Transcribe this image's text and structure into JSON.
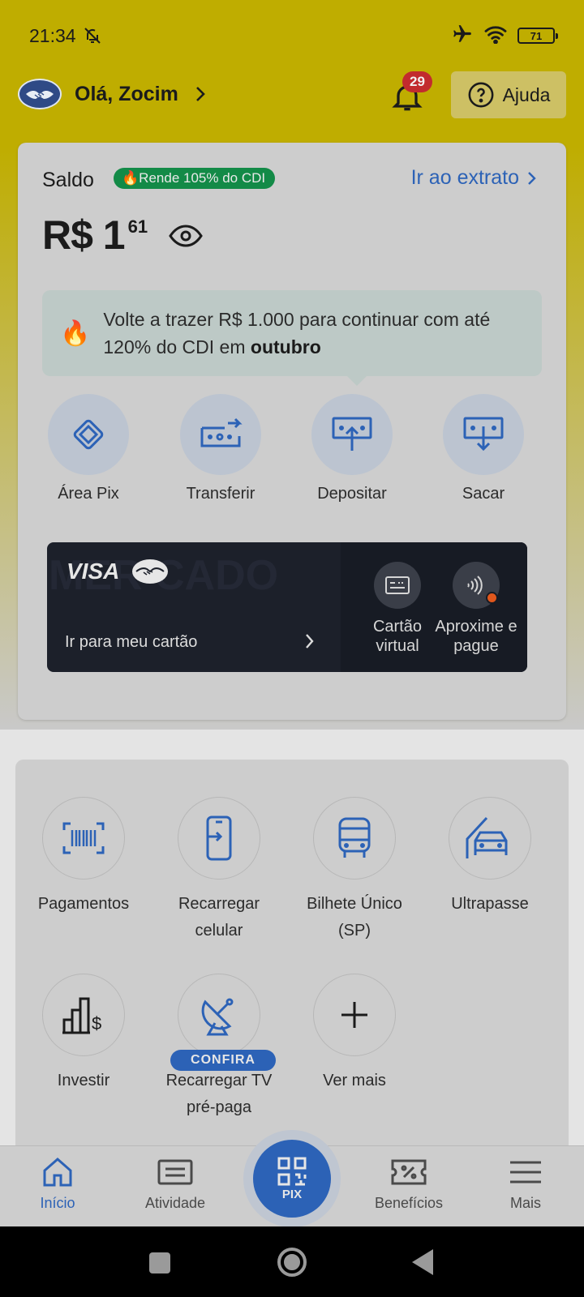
{
  "status_bar": {
    "time": "21:34",
    "battery": "71"
  },
  "header": {
    "greeting": "Olá, Zocim",
    "notification_count": "29",
    "help_label": "Ajuda"
  },
  "balance_card": {
    "saldo_label": "Saldo",
    "rende_badge": "Rende 105% do CDI",
    "extrato_link": "Ir ao extrato",
    "amount_main": "R$ 1",
    "amount_cents": "61",
    "tip_text_prefix": "Volte a trazer R$ 1.000 para continuar com até 120% do CDI em ",
    "tip_text_bold": "outubro",
    "actions": [
      {
        "label": "Área Pix",
        "icon": "pix-icon"
      },
      {
        "label": "Transferir",
        "icon": "transfer-icon"
      },
      {
        "label": "Depositar",
        "icon": "deposit-icon"
      },
      {
        "label": "Sacar",
        "icon": "withdraw-icon"
      }
    ]
  },
  "visa_card": {
    "brand": "VISA",
    "watermark": "MER CADO",
    "goto_label": "Ir para meu cartão",
    "virtual_label": "Cartão virtual",
    "contactless_label": "Aproxime e pague"
  },
  "services": {
    "items": [
      {
        "label": "Pagamentos",
        "icon": "barcode-icon"
      },
      {
        "label": "Recarregar celular",
        "icon": "phone-recharge-icon"
      },
      {
        "label": "Bilhete Único (SP)",
        "icon": "bus-icon"
      },
      {
        "label": "Ultrapasse",
        "icon": "toll-car-icon"
      },
      {
        "label": "Investir",
        "icon": "invest-icon"
      },
      {
        "label": "Recarregar TV pré-paga",
        "icon": "satellite-dish-icon"
      },
      {
        "label": "Ver mais",
        "icon": "plus-icon"
      }
    ],
    "confira_badge": "CONFIRA"
  },
  "bottom_nav": {
    "items": [
      {
        "label": "Início",
        "icon": "home-icon",
        "active": true
      },
      {
        "label": "Atividade",
        "icon": "activity-icon"
      },
      {
        "label": "PIX",
        "icon": "qr-code-icon"
      },
      {
        "label": "Benefícios",
        "icon": "coupon-icon"
      },
      {
        "label": "Mais",
        "icon": "menu-icon"
      }
    ]
  },
  "colors": {
    "brand_yellow": "#bfad00",
    "accent_blue": "#2c62b6",
    "badge_green": "#138a47",
    "notification_red": "#c22b2e"
  }
}
